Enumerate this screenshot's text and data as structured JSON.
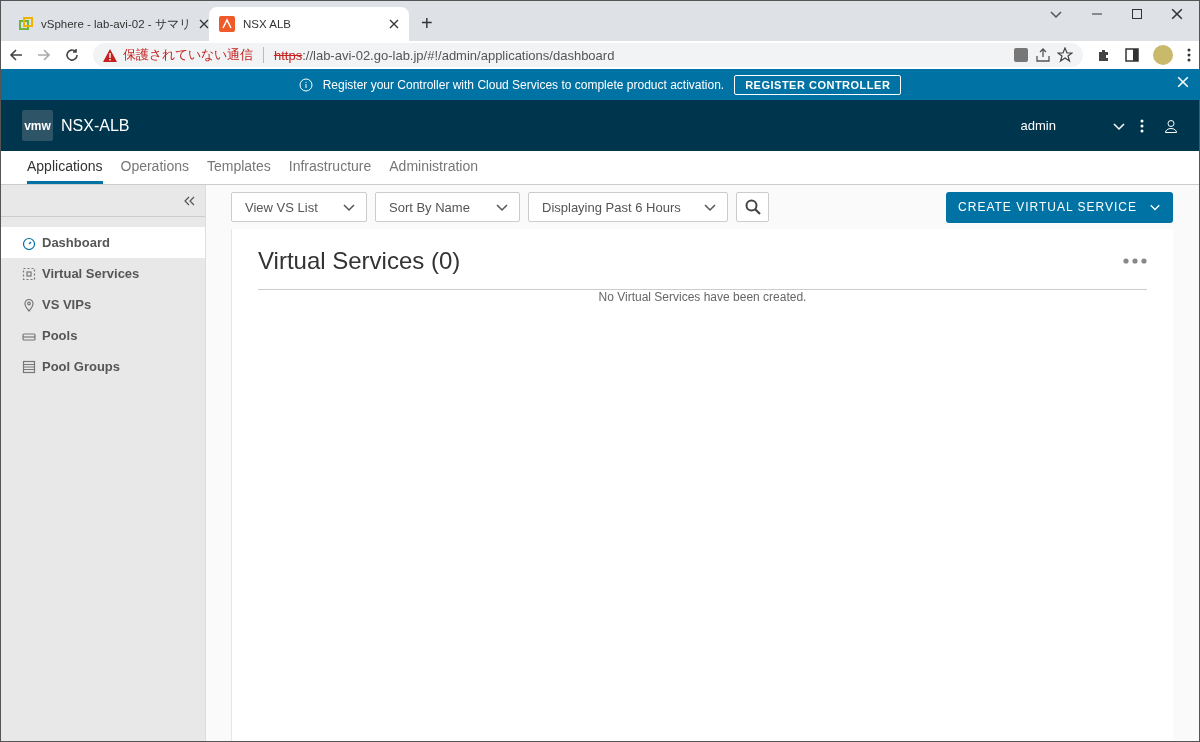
{
  "browser": {
    "tabs": [
      {
        "title": "vSphere - lab-avi-02 - サマリ",
        "selected": false,
        "kind": "vsphere"
      },
      {
        "title": "NSX ALB",
        "selected": true,
        "kind": "alb"
      }
    ],
    "new_tab": "+",
    "security": "保護されていない通信",
    "url_scheme": "https",
    "url_rest": "://lab-avi-02.go-lab.jp/#!/admin/applications/dashboard"
  },
  "banner": {
    "message": "Register your Controller with Cloud Services to complete product activation.",
    "button": "REGISTER CONTROLLER"
  },
  "header": {
    "logo": "vmw",
    "product": "NSX-ALB",
    "user": "admin"
  },
  "nav_tabs": [
    {
      "label": "Applications",
      "selected": true
    },
    {
      "label": "Operations",
      "selected": false
    },
    {
      "label": "Templates",
      "selected": false
    },
    {
      "label": "Infrastructure",
      "selected": false
    },
    {
      "label": "Administration",
      "selected": false
    }
  ],
  "sidebar": {
    "items": [
      {
        "label": "Dashboard",
        "selected": true,
        "kind": "gauge"
      },
      {
        "label": "Virtual Services",
        "selected": false,
        "kind": "vs"
      },
      {
        "label": "VS VIPs",
        "selected": false,
        "kind": "pin"
      },
      {
        "label": "Pools",
        "selected": false,
        "kind": "pool"
      },
      {
        "label": "Pool Groups",
        "selected": false,
        "kind": "groups"
      }
    ]
  },
  "toolbar": {
    "dropdowns": [
      "View VS List",
      "Sort By Name",
      "Displaying Past 6 Hours"
    ],
    "create_button": "CREATE VIRTUAL SERVICE"
  },
  "panel": {
    "title": "Virtual Services (0)",
    "empty_message": "No Virtual Services have been created."
  }
}
